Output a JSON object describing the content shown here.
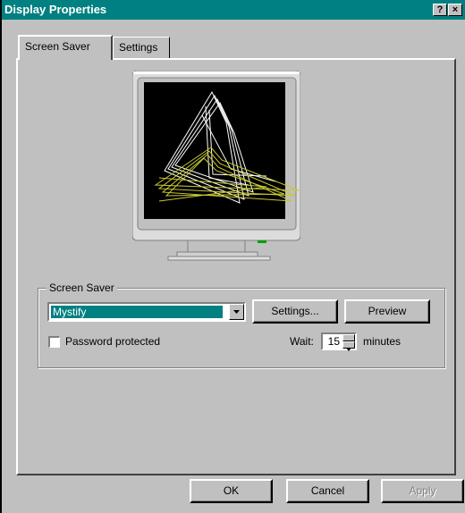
{
  "window": {
    "title": "Display Properties",
    "help_label": "?",
    "close_label": "×"
  },
  "tabs": [
    {
      "label": "Screen Saver",
      "active": true
    },
    {
      "label": "Settings",
      "active": false
    }
  ],
  "screensaver_group": {
    "label": "Screen Saver",
    "selected": "Mystify",
    "settings_label": "Settings...",
    "preview_label": "Preview",
    "password_label": "Password protected",
    "password_checked": false,
    "wait_label": "Wait:",
    "wait_value": "15",
    "minutes_label": "minutes"
  },
  "buttons": {
    "ok": "OK",
    "cancel": "Cancel",
    "apply": "Apply"
  },
  "colors": {
    "titlebar": "#008080",
    "face": "#c0c0c0",
    "selection": "#008080",
    "mystify_lines_1": "#ffffff",
    "mystify_lines_2": "#c8c832"
  }
}
